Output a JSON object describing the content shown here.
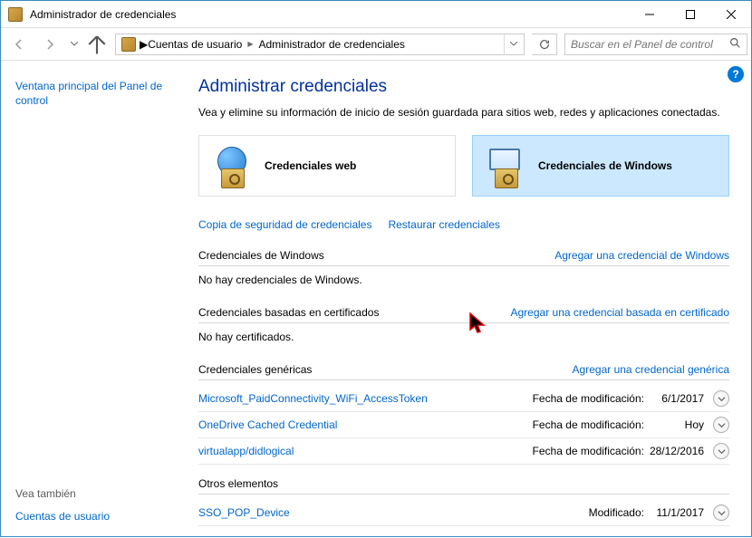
{
  "titlebar": {
    "title": "Administrador de credenciales"
  },
  "address": {
    "parts": [
      "Cuentas de usuario",
      "Administrador de credenciales"
    ]
  },
  "search": {
    "placeholder": "Buscar en el Panel de control"
  },
  "sidebar": {
    "main_link": "Ventana principal del Panel de control",
    "see_also_label": "Vea también",
    "see_also_link": "Cuentas de usuario"
  },
  "page": {
    "title": "Administrar credenciales",
    "desc": "Vea y elimine su información de inicio de sesión guardada para sitios web, redes y aplicaciones conectadas."
  },
  "tiles": {
    "web": "Credenciales web",
    "windows": "Credenciales de Windows"
  },
  "actions": {
    "backup": "Copia de seguridad de credenciales",
    "restore": "Restaurar credenciales"
  },
  "sections": {
    "windows": {
      "title": "Credenciales de Windows",
      "add_link": "Agregar una credencial de Windows",
      "empty": "No hay credenciales de Windows."
    },
    "cert": {
      "title": "Credenciales basadas en certificados",
      "add_link": "Agregar una credencial basada en certificado",
      "empty": "No hay certificados."
    },
    "generic": {
      "title": "Credenciales genéricas",
      "add_link": "Agregar una credencial genérica",
      "mod_label": "Fecha de modificación:",
      "items": [
        {
          "name": "Microsoft_PaidConnectivity_WiFi_AccessToken",
          "date": "6/1/2017"
        },
        {
          "name": "OneDrive Cached Credential",
          "date": "Hoy"
        },
        {
          "name": "virtualapp/didlogical",
          "date": "28/12/2016"
        }
      ]
    },
    "other": {
      "title": "Otros elementos",
      "mod_label": "Modificado:",
      "items": [
        {
          "name": "SSO_POP_Device",
          "date": "11/1/2017"
        }
      ]
    }
  }
}
